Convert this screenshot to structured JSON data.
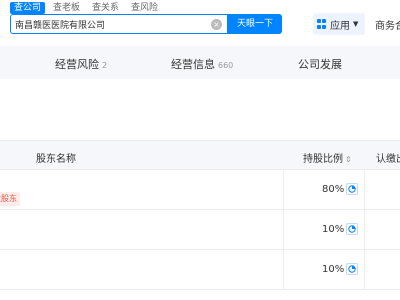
{
  "header": {
    "search_tabs": [
      "查公司",
      "查老板",
      "查关系",
      "查风险"
    ],
    "search_value": "南昌赣医医院有限公司",
    "search_button": "天眼一下",
    "app_button": "应用",
    "header_link": "商务合作"
  },
  "nav": {
    "tabs": [
      {
        "label": "经营风险",
        "count": "2"
      },
      {
        "label": "经营信息",
        "count": "660"
      },
      {
        "label": "公司发展",
        "count": ""
      }
    ]
  },
  "table": {
    "headers": {
      "name": "股东名称",
      "ratio": "持股比例",
      "subscribed": "认缴出资额"
    },
    "rows": [
      {
        "tag": "大股东",
        "ratio": "80%"
      },
      {
        "tag": "",
        "ratio": "10%"
      },
      {
        "tag": "",
        "ratio": "10%"
      }
    ]
  },
  "colors": {
    "accent": "#0084ff",
    "tag_red": "#e45b4a"
  }
}
